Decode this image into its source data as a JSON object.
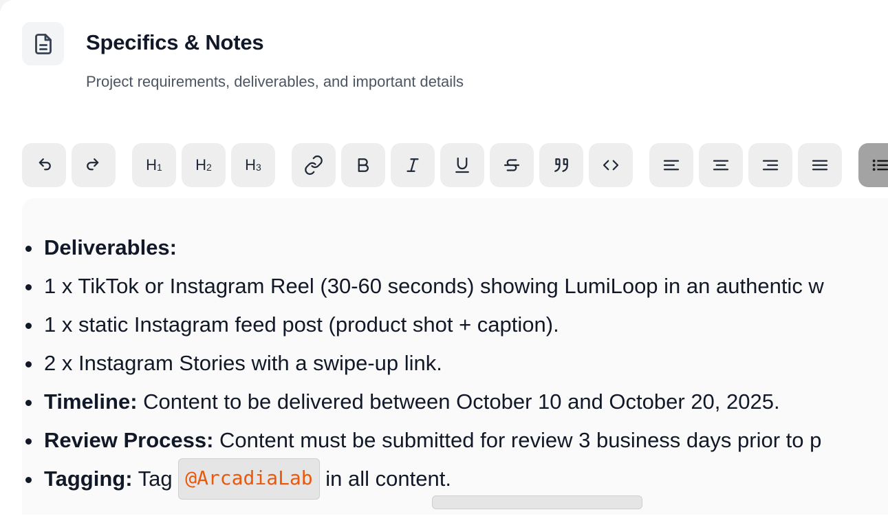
{
  "section": {
    "title": "Specifics & Notes",
    "subtitle": "Project requirements, deliverables, and important details",
    "icon": "document-icon"
  },
  "toolbar": {
    "buttons": [
      {
        "name": "undo-button",
        "icon": "undo-icon"
      },
      {
        "name": "redo-button",
        "icon": "redo-icon"
      },
      {
        "name": "heading-1-button",
        "label": "H",
        "sub": "1"
      },
      {
        "name": "heading-2-button",
        "label": "H",
        "sub": "2"
      },
      {
        "name": "heading-3-button",
        "label": "H",
        "sub": "3"
      },
      {
        "name": "link-button",
        "icon": "link-icon"
      },
      {
        "name": "bold-button",
        "icon": "bold-icon"
      },
      {
        "name": "italic-button",
        "icon": "italic-icon"
      },
      {
        "name": "underline-button",
        "icon": "underline-icon"
      },
      {
        "name": "strikethrough-button",
        "icon": "strikethrough-icon"
      },
      {
        "name": "quote-button",
        "icon": "quote-icon"
      },
      {
        "name": "code-button",
        "icon": "code-icon"
      },
      {
        "name": "align-left-button",
        "icon": "align-left-icon"
      },
      {
        "name": "align-center-button",
        "icon": "align-center-icon"
      },
      {
        "name": "align-right-button",
        "icon": "align-right-icon"
      },
      {
        "name": "align-justify-button",
        "icon": "align-justify-icon"
      },
      {
        "name": "bullet-list-button",
        "icon": "bullet-list-icon",
        "active": true
      }
    ]
  },
  "editor": {
    "items": [
      {
        "bold": "Deliverables:",
        "text": ""
      },
      {
        "bold": "",
        "text": "1 x TikTok or Instagram Reel (30-60 seconds) showing LumiLoop in an authentic w"
      },
      {
        "bold": "",
        "text": "1 x static Instagram feed post (product shot + caption)."
      },
      {
        "bold": "",
        "text": "2 x Instagram Stories with a swipe-up link."
      },
      {
        "bold": "Timeline:",
        "text": " Content to be delivered between October 10 and October 20, 2025."
      },
      {
        "bold": "Review Process:",
        "text": " Content must be submitted for review 3 business days prior to p"
      },
      {
        "bold": "Tagging:",
        "text_before": " Tag ",
        "mention": "@ArcadiaLab",
        "text_after": " in all content."
      }
    ]
  },
  "colors": {
    "accent_mention": "#ea580c",
    "active_button": "#a3a3a3",
    "button_bg": "#eeeeee"
  }
}
